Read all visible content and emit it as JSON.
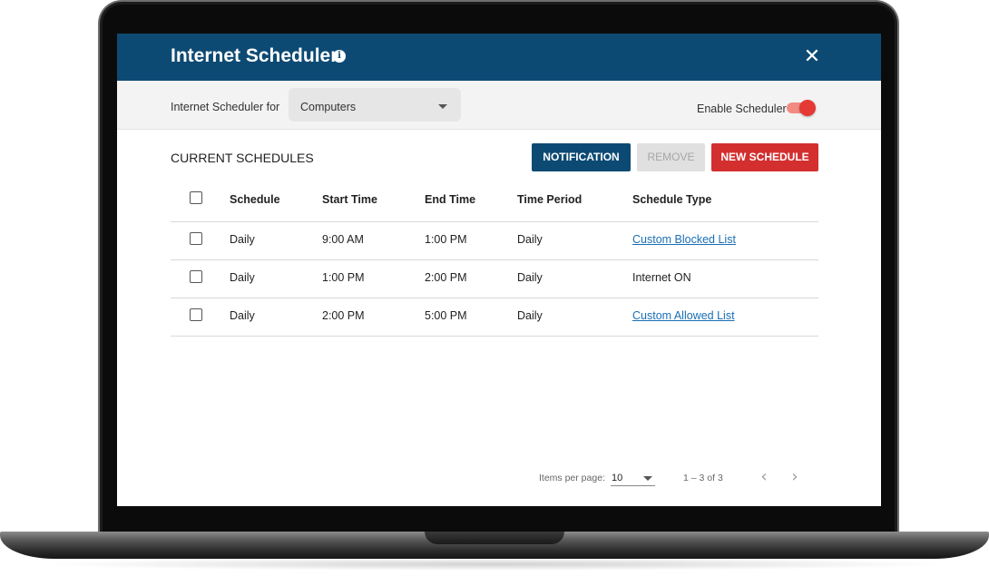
{
  "header": {
    "title": "Internet Scheduler",
    "info_icon": "info-icon",
    "close_icon": "✕"
  },
  "filter": {
    "label": "Internet Scheduler for",
    "selected": "Computers",
    "enable_label": "Enable Scheduler",
    "enabled": true
  },
  "schedules": {
    "title": "CURRENT SCHEDULES",
    "buttons": {
      "notification": "NOTIFICATION",
      "remove": "REMOVE",
      "new_schedule": "NEW SCHEDULE"
    },
    "columns": [
      "Schedule",
      "Start Time",
      "End Time",
      "Time Period",
      "Schedule Type"
    ],
    "rows": [
      [
        "Daily",
        "9:00 AM",
        "1:00 PM",
        "Daily",
        "Custom Blocked List"
      ],
      [
        "Daily",
        "1:00 PM",
        "2:00 PM",
        "Daily",
        "Internet ON"
      ],
      [
        "Daily",
        "2:00 PM",
        "5:00 PM",
        "Daily",
        "Custom Allowed List"
      ]
    ]
  },
  "pagination": {
    "items_label": "Items per page:",
    "items_per_page": "10",
    "range": "1 – 3 of 3",
    "prev": "‹",
    "next": "›"
  },
  "colors": {
    "header_bg": "#0d4a73",
    "new_button": "#d32f2f",
    "toggle_on": "#e53935",
    "link": "#1a6fb5"
  }
}
